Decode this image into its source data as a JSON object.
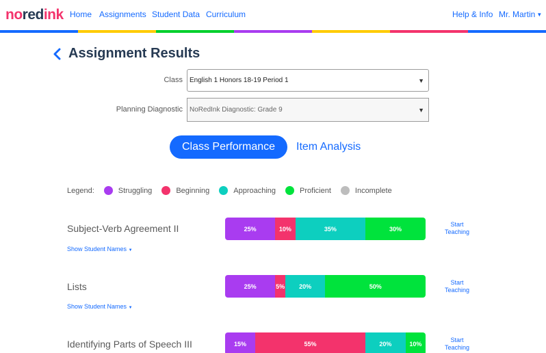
{
  "nav": {
    "logo": [
      "no",
      "red",
      "ink"
    ],
    "links": [
      "Home",
      "Assignments",
      "Student Data",
      "Curriculum"
    ],
    "help": "Help & Info",
    "user": "Mr. Martin"
  },
  "colors": {
    "rainbow": [
      "#146aff",
      "#ffcb00",
      "#00d02c",
      "#a93cf0",
      "#ffcb00",
      "#f3336c",
      "#146aff"
    ],
    "struggling": "#a93cf0",
    "beginning": "#f3336c",
    "approaching": "#0dcfbf",
    "proficient": "#00e33c",
    "incomplete": "#bdbdbd"
  },
  "page": {
    "title": "Assignment Results"
  },
  "filters": {
    "class_label": "Class",
    "class_value": "English 1 Honors 18-19 Period 1",
    "diagnostic_label": "Planning Diagnostic",
    "diagnostic_value": "NoRedInk Diagnostic: Grade 9"
  },
  "tabs": {
    "active": "Class Performance",
    "other": "Item Analysis"
  },
  "legend": {
    "label": "Legend:",
    "items": [
      "Struggling",
      "Beginning",
      "Approaching",
      "Proficient",
      "Incomplete"
    ]
  },
  "rows": [
    {
      "title": "Subject-Verb Agreement II",
      "show": "Show Student Names",
      "start": [
        "Start",
        "Teaching"
      ],
      "values": [
        25,
        10,
        35,
        30
      ],
      "labels": [
        "25%",
        "10%",
        "35%",
        "30%"
      ]
    },
    {
      "title": "Lists",
      "show": "Show Student Names",
      "start": [
        "Start",
        "Teaching"
      ],
      "values": [
        25,
        5,
        20,
        50
      ],
      "labels": [
        "25%",
        "5%",
        "20%",
        "50%"
      ]
    },
    {
      "title": "Identifying Parts of Speech III",
      "start": [
        "Start",
        "Teaching"
      ],
      "values": [
        15,
        55,
        20,
        10
      ],
      "labels": [
        "15%",
        "55%",
        "20%",
        "10%"
      ]
    }
  ]
}
